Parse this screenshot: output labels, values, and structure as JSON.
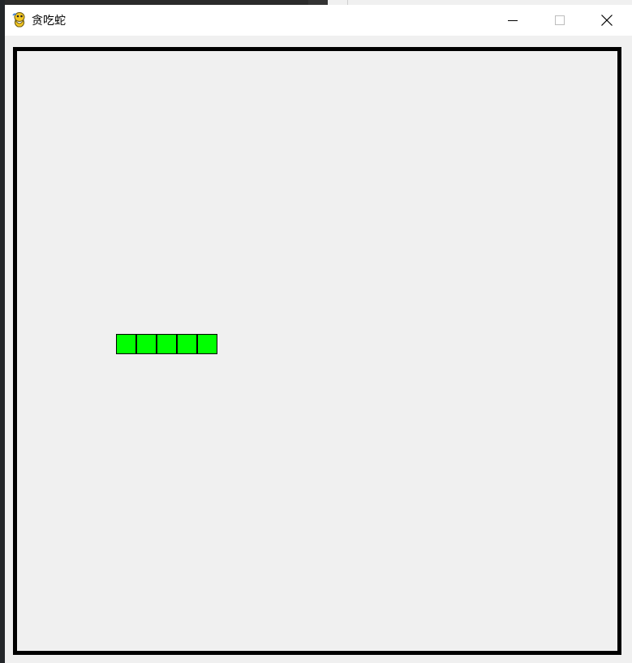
{
  "window": {
    "title": "贪吃蛇",
    "app_icon": "pygame-snake-icon"
  },
  "controls": {
    "minimize_icon": "minimize-icon",
    "maximize_icon": "maximize-icon",
    "close_icon": "close-icon"
  },
  "game": {
    "grid_cell_count": 30,
    "snake_color": "#00ff00",
    "board_border_color": "#000000",
    "board_background": "#f0f0f0",
    "snake": [
      {
        "col": 5,
        "row": 14
      },
      {
        "col": 6,
        "row": 14
      },
      {
        "col": 7,
        "row": 14
      },
      {
        "col": 8,
        "row": 14
      },
      {
        "col": 9,
        "row": 14
      }
    ]
  }
}
